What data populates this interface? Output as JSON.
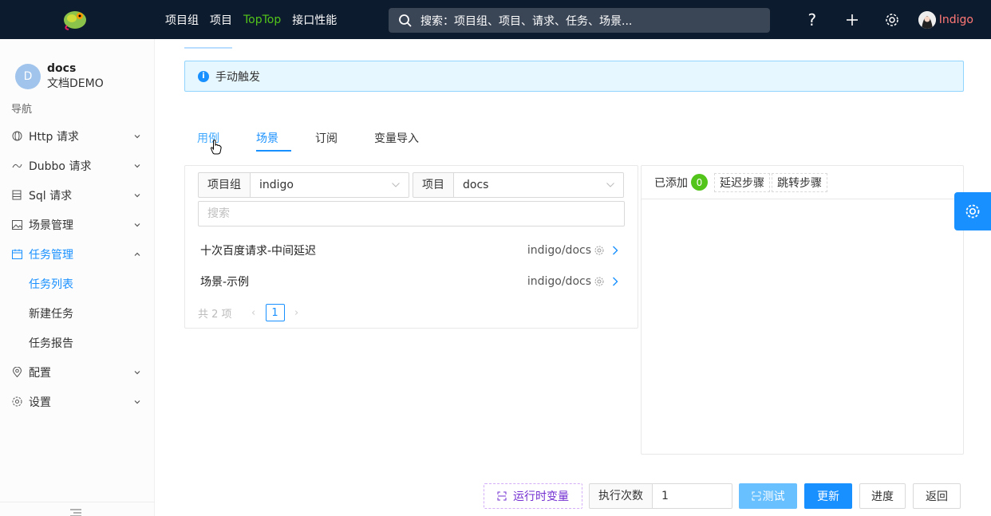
{
  "topbar": {
    "nav": [
      "项目组",
      "项目",
      "TopTop",
      "接口性能"
    ],
    "active_nav_index": 2,
    "search_placeholder": "搜索：项目组、项目、请求、任务、场景...",
    "user_name": "Indigo",
    "icons": [
      "help-icon",
      "plus-icon",
      "gear-icon"
    ]
  },
  "sidebar": {
    "project_avatar": "D",
    "project_name": "docs",
    "project_sub": "文档DEMO",
    "nav_title": "导航",
    "items": [
      {
        "label": "Http 请求",
        "icon": "globe-icon"
      },
      {
        "label": "Dubbo 请求",
        "icon": "dubbo-icon"
      },
      {
        "label": "Sql 请求",
        "icon": "database-icon"
      },
      {
        "label": "场景管理",
        "icon": "image-icon"
      },
      {
        "label": "任务管理",
        "icon": "calendar-icon"
      },
      {
        "label": "配置",
        "icon": "location-icon"
      },
      {
        "label": "设置",
        "icon": "gear-icon"
      }
    ],
    "sub_items": [
      "任务列表",
      "新建任务",
      "任务报告"
    ]
  },
  "alert": {
    "text": "手动触发"
  },
  "tabs": [
    "用例",
    "场景",
    "订阅",
    "变量导入"
  ],
  "active_tab_index": 1,
  "left_panel": {
    "group_label": "项目组",
    "group_value": "indigo",
    "project_label": "项目",
    "project_value": "docs",
    "search_placeholder": "搜索",
    "items": [
      {
        "name": "十次百度请求-中间延迟",
        "path": "indigo/docs"
      },
      {
        "name": "场景-示例",
        "path": "indigo/docs"
      }
    ],
    "pager": {
      "total": "共 2 项",
      "current": "1"
    }
  },
  "right_panel": {
    "added_label": "已添加",
    "count": "0",
    "delay_btn": "延迟步骤",
    "jump_btn": "跳转步骤"
  },
  "bottom": {
    "runtime_var": "运行时变量",
    "exec_label": "执行次数",
    "exec_value": "1",
    "test": "测试",
    "update": "更新",
    "progress": "进度",
    "back": "返回"
  },
  "colors": {
    "topbar_bg": "#0d1b2e",
    "primary": "#1890ff",
    "active_nav": "#52c41a",
    "user_name": "#ff7875",
    "runtime_var": "#722ed1"
  }
}
